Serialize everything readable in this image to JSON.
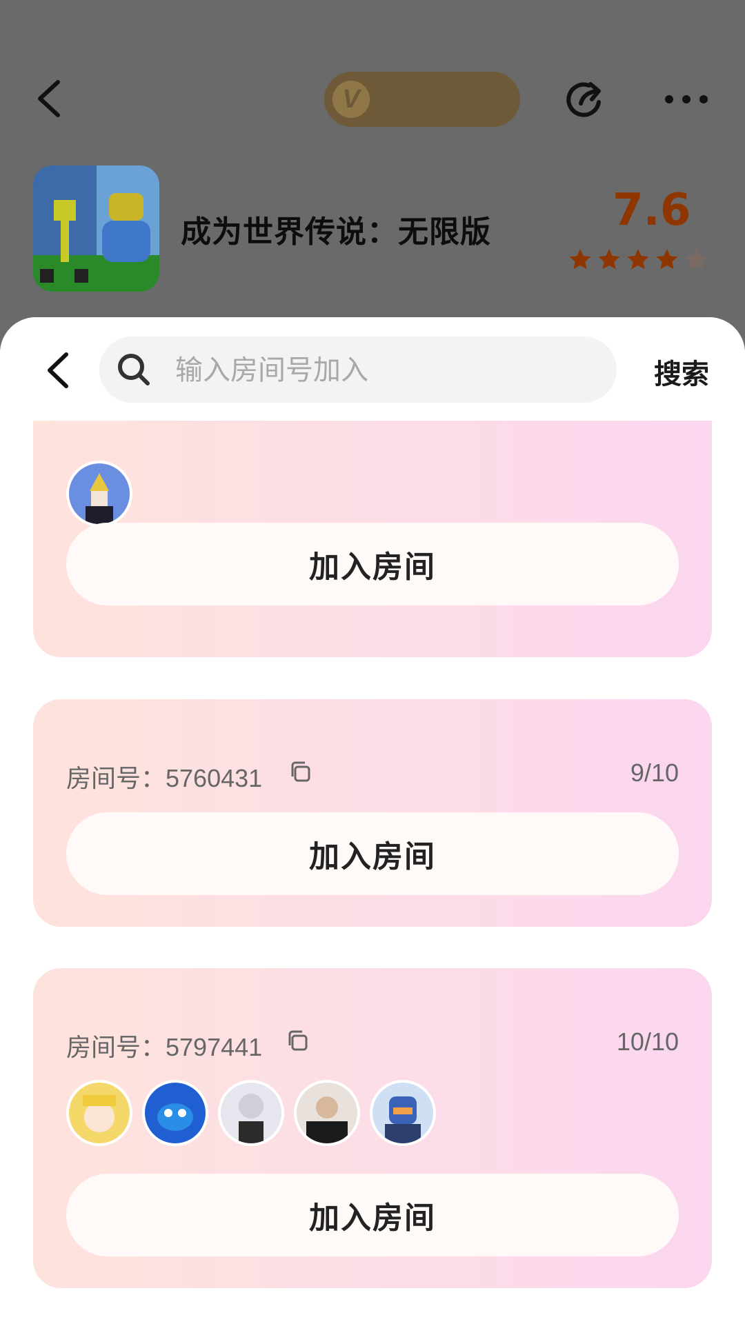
{
  "header": {
    "vip_badge": "V",
    "game_title": "成为世界传说：无限版",
    "score": "7.6",
    "rating_stars": 4.5
  },
  "search": {
    "placeholder": "输入房间号加入",
    "button_label": "搜索"
  },
  "rooms": [
    {
      "room_label": "",
      "count": "",
      "avatar_colors": [
        "#5d7fd6"
      ],
      "join_label": "加入房间"
    },
    {
      "room_label": "房间号：5760431",
      "count": "9/10",
      "avatar_colors": [],
      "join_label": "加入房间"
    },
    {
      "room_label": "房间号：5797441",
      "count": "10/10",
      "avatar_colors": [
        "#f4d86a",
        "#1f5fd1",
        "#e6e6ee",
        "#1a1a1a",
        "#3a63b8"
      ],
      "join_label": "加入房间"
    }
  ],
  "colors": {
    "accent": "#8e3500",
    "vip": "#6e5a39"
  }
}
